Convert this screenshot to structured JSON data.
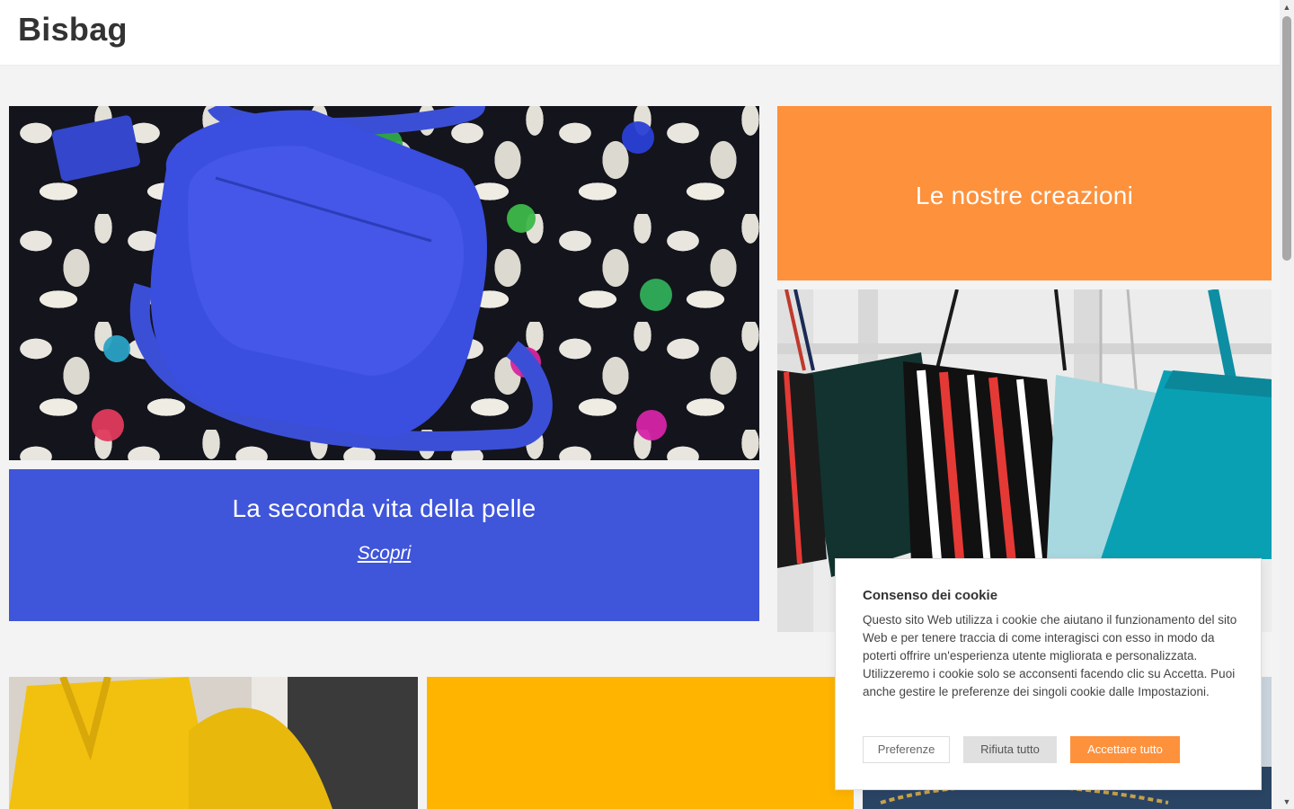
{
  "site": {
    "logo": "Bisbag"
  },
  "hero": {
    "title": "La seconda vita della pelle",
    "link": "Scopri",
    "panel_color": "#3f55da",
    "image_icon": "blue-bag-photo"
  },
  "creations": {
    "title": "Le nostre creazioni",
    "panel_color": "#fe913c",
    "image_icon": "hanging-bags-photo"
  },
  "tiles": {
    "left_image_icon": "yellow-bag-photo",
    "middle_color": "#ffb400",
    "right_image_icon": "blue-bag-chain-photo"
  },
  "cookie": {
    "title": "Consenso dei cookie",
    "text": "Questo sito Web utilizza i cookie che aiutano il funzionamento del sito Web e per tenere traccia di come interagisci con esso in modo da poterti offrire un'esperienza utente migliorata e personalizzata. Utilizzeremo i cookie solo se acconsenti facendo clic su Accetta. Puoi anche gestire le preferenze dei singoli cookie dalle Impostazioni.",
    "buttons": {
      "preferences": "Preferenze",
      "reject": "Rifiuta tutto",
      "accept": "Accettare tutto"
    },
    "accent_color": "#fe913c"
  },
  "scrollbar": {
    "up_icon": "▲",
    "down_icon": "▼"
  }
}
